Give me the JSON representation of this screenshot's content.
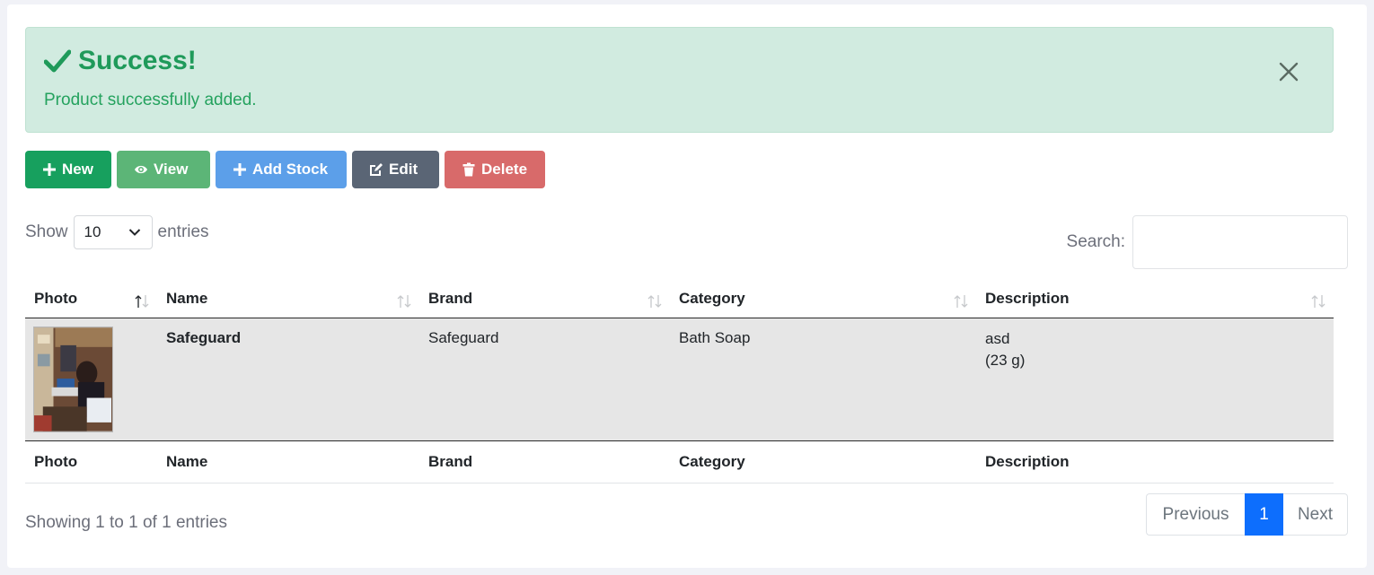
{
  "alert": {
    "title": "Success!",
    "message": "Product successfully added.",
    "color": "#1f9a5a",
    "background": "#d1ebe0"
  },
  "toolbar": {
    "new_label": "New",
    "view_label": "View",
    "add_stock_label": "Add Stock",
    "edit_label": "Edit",
    "delete_label": "Delete"
  },
  "length_menu": {
    "show_label": "Show",
    "selected": "10",
    "entries_label": "entries"
  },
  "search": {
    "label": "Search:",
    "value": ""
  },
  "table": {
    "columns": [
      "Photo",
      "Name",
      "Brand",
      "Category",
      "Description"
    ],
    "rows": [
      {
        "name": "Safeguard",
        "brand": "Safeguard",
        "category": "Bath Soap",
        "description_line1": "asd",
        "description_line2": "(23 g)"
      }
    ]
  },
  "footer": {
    "info": "Showing 1 to 1 of 1 entries",
    "previous": "Previous",
    "current_page": "1",
    "next": "Next"
  },
  "colors": {
    "new": "#17a05e",
    "view": "#5cb577",
    "add_stock": "#5c9fe9",
    "edit": "#5a6575",
    "delete": "#d86a6a",
    "active_page": "#0d6efd"
  }
}
